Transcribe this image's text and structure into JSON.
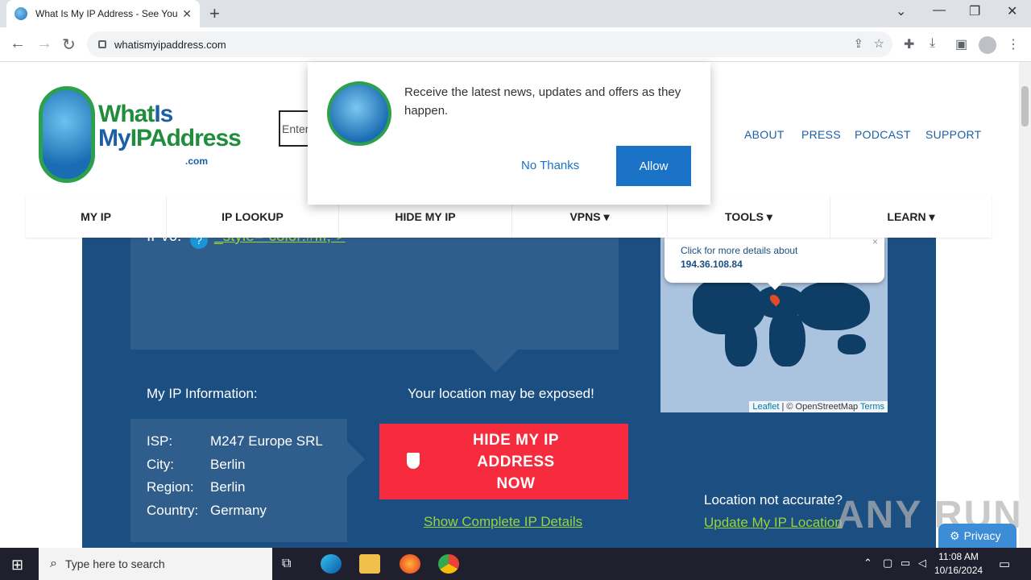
{
  "browser": {
    "tab_title": "What Is My IP Address - See You",
    "tab_close": "✕",
    "new_tab": "+",
    "window_controls": [
      "⌄",
      "—",
      "❐",
      "✕"
    ],
    "url": "whatismyipaddress.com"
  },
  "site": {
    "logo_line1_a": "What",
    "logo_line1_b": "Is",
    "logo_line2_a": "My",
    "logo_line2_b": "IPAddress",
    "logo_dotcom": ".com",
    "search_placeholder": "Enter",
    "top_nav": [
      "ABOUT",
      "PRESS",
      "PODCAST",
      "SUPPORT"
    ],
    "main_nav": [
      "MY IP",
      "IP LOOKUP",
      "HIDE MY IP",
      "VPNS ▾",
      "TOOLS ▾",
      "LEARN ▾"
    ]
  },
  "hero": {
    "ipv6_label": "IPv6:",
    "ipv6_help": "?",
    "ipv6_value": "_style=\"color:#fff;\">",
    "info_title": "My IP Information:",
    "exposed_text": "Your location may be exposed!",
    "info_rows": [
      {
        "key": "ISP:",
        "value": "M247 Europe SRL"
      },
      {
        "key": "City:",
        "value": "Berlin"
      },
      {
        "key": "Region:",
        "value": "Berlin"
      },
      {
        "key": "Country:",
        "value": "Germany"
      }
    ],
    "hide_button_line1": "HIDE MY IP ADDRESS",
    "hide_button_line2": "NOW",
    "show_details": "Show Complete IP Details",
    "location_question": "Location not accurate?",
    "update_location": "Update My IP Location"
  },
  "map": {
    "popup_line1": "Click for more details about",
    "popup_ip": "194.36.108.84",
    "popup_close": "×",
    "attrib_leaflet": "Leaflet",
    "attrib_sep": " | © OpenStreetMap ",
    "attrib_terms": "Terms"
  },
  "prompt": {
    "message": "Receive the latest news, updates and offers as they happen.",
    "no_thanks": "No Thanks",
    "allow": "Allow"
  },
  "privacy_badge": "Privacy",
  "watermark": "ANY RUN",
  "taskbar": {
    "search_placeholder": "Type here to search",
    "time": "11:08 AM",
    "date": "10/16/2024"
  },
  "colors": {
    "hero_bg": "#1b4f82",
    "panel_bg": "#2f5e8c",
    "accent_green": "#9bd23c",
    "hide_button": "#f62b3e",
    "link_blue": "#1d5fa5",
    "allow_button": "#1a73c6"
  }
}
